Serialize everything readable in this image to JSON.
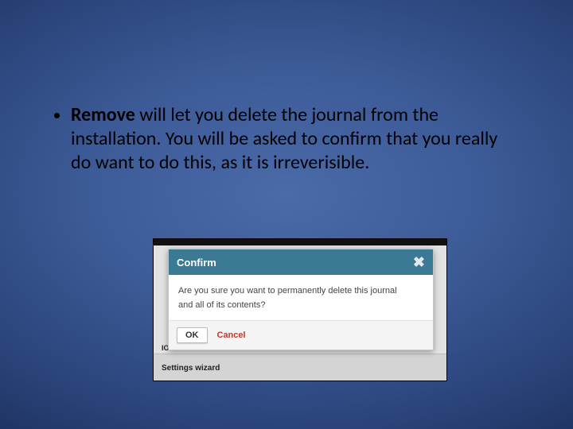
{
  "bullet": {
    "bold": "Remove",
    "rest": " will let you delete the journal from the installation. You will be asked to confirm that you really do want to do this, as it is irreverisible."
  },
  "dialog": {
    "title": "Confirm",
    "body_line1": "Are you sure you want to permanently delete this journal",
    "body_line2": "and all of its contents?",
    "ok_label": "OK",
    "cancel_label": "Cancel"
  },
  "background": {
    "partial_label_left": "IOW",
    "settings_wizard": "Settings wizard"
  }
}
